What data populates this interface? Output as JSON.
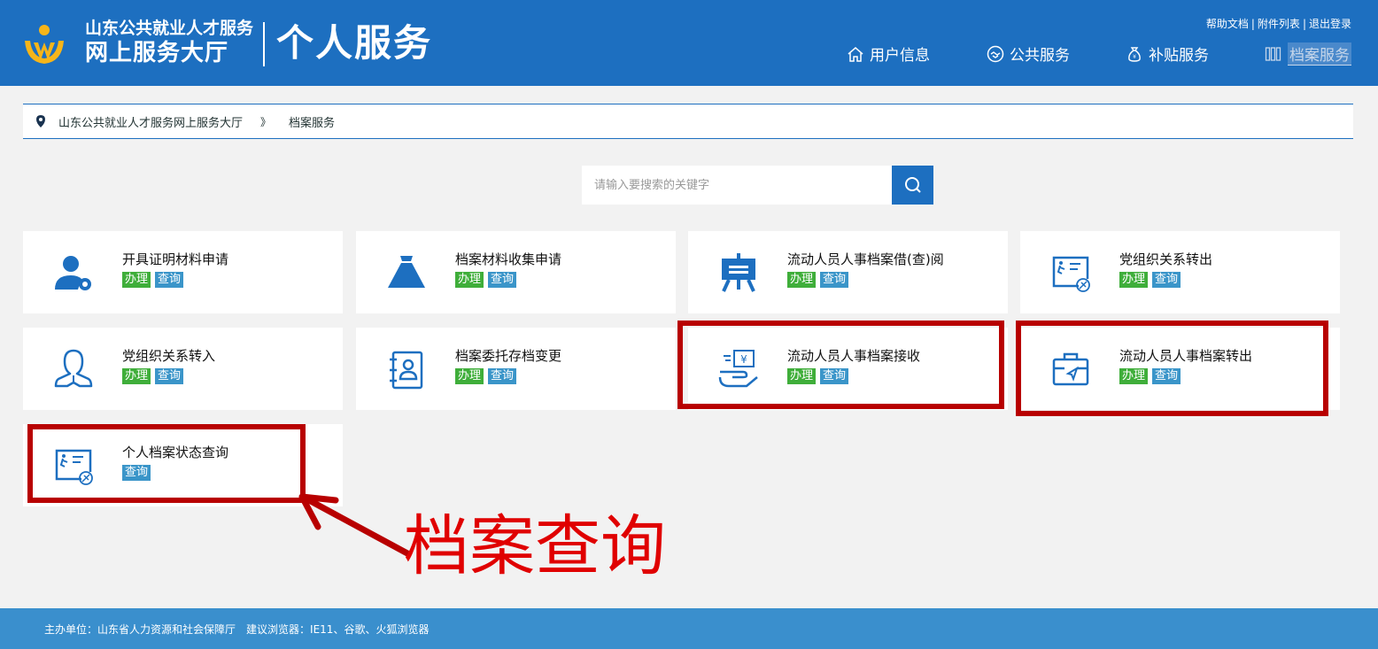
{
  "header": {
    "org_name": "山东公共就业人才服务",
    "hall_name": "网上服务大厅",
    "section_title": "个人服务",
    "top_links": [
      "帮助文档",
      "附件列表",
      "退出登录"
    ],
    "nav": [
      {
        "label": "用户信息",
        "icon": "home-icon"
      },
      {
        "label": "公共服务",
        "icon": "handshake-icon"
      },
      {
        "label": "补贴服务",
        "icon": "money-bag-icon"
      },
      {
        "label": "档案服务",
        "icon": "archive-icon",
        "active": true
      }
    ]
  },
  "breadcrumb": {
    "root": "山东公共就业人才服务网上服务大厅",
    "separator": "》",
    "current": "档案服务"
  },
  "search": {
    "placeholder": "请输入要搜索的关键字"
  },
  "services": [
    {
      "title": "开具证明材料申请",
      "icon": "user-settings-icon",
      "buttons": [
        "办理",
        "查询"
      ]
    },
    {
      "title": "档案材料收集申请",
      "icon": "funnel-icon",
      "buttons": [
        "办理",
        "查询"
      ]
    },
    {
      "title": "流动人员人事档案借(查)阅",
      "icon": "easel-icon",
      "buttons": [
        "办理",
        "查询"
      ]
    },
    {
      "title": "党组织关系转出",
      "icon": "transfer-card-icon",
      "buttons": [
        "办理",
        "查询"
      ]
    },
    {
      "title": "党组织关系转入",
      "icon": "person-outline-icon",
      "buttons": [
        "办理",
        "查询"
      ]
    },
    {
      "title": "档案委托存档变更",
      "icon": "contact-book-icon",
      "buttons": [
        "办理",
        "查询"
      ]
    },
    {
      "title": "流动人员人事档案接收",
      "icon": "hand-receive-icon",
      "buttons": [
        "办理",
        "查询"
      ]
    },
    {
      "title": "流动人员人事档案转出",
      "icon": "briefcase-send-icon",
      "buttons": [
        "办理",
        "查询"
      ]
    },
    {
      "title": "个人档案状态查询",
      "icon": "transfer-card-icon",
      "buttons": [
        "查询"
      ]
    }
  ],
  "annotation": {
    "text": "档案查询"
  },
  "footer": {
    "sponsor_label": "主办单位：",
    "sponsor": "山东省人力资源和社会保障厅",
    "browser_label": "建议浏览器：",
    "browsers": "IE11、谷歌、火狐浏览器"
  }
}
